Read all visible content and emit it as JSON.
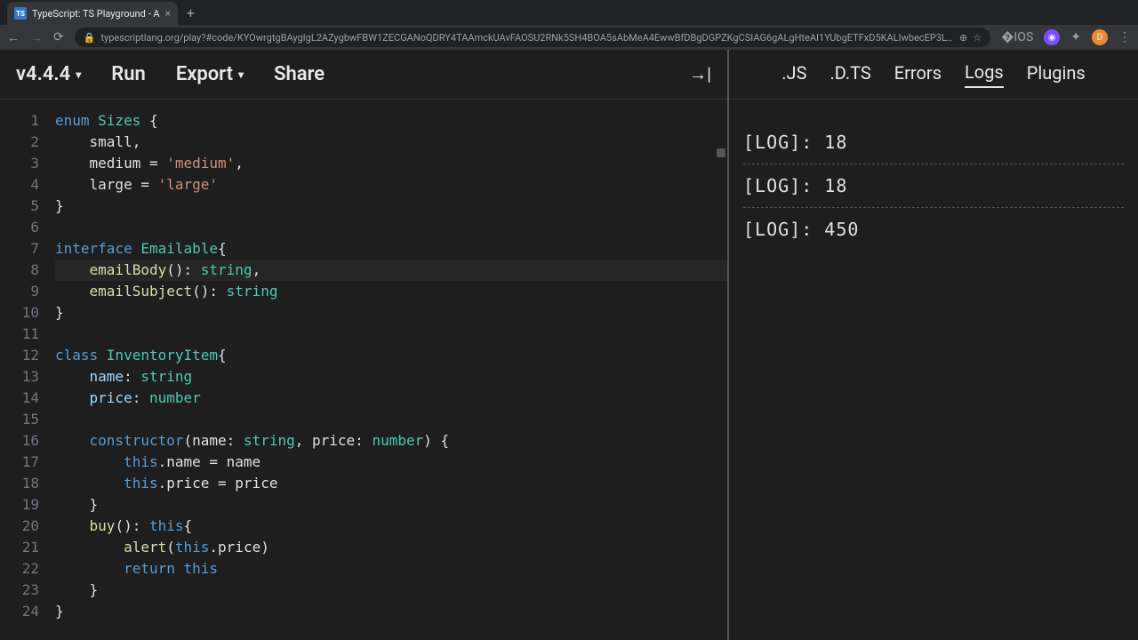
{
  "browser": {
    "tab_title": "TypeScript: TS Playground - A",
    "tab_favicon_text": "TS",
    "url": "typescriptlang.org/play?#code/KYOwrgtgBAygIgL2AZygbwFBW1ZECGANoQDRY4TAAmckUAvFAOSU2RNk5SH4BOA5sAbMeA4EwwBfDBgDGPZKgCSIAG6gALgHteAI1YUbgETFxD5KALIwbecEP3LYADrdnAr4CACNgvGV1ktEGQbMfItX..."
  },
  "toolbar": {
    "version": "v4.4.4",
    "run": "Run",
    "export": "Export",
    "share": "Share"
  },
  "code": {
    "lines": [
      {
        "n": 1,
        "tokens": [
          {
            "t": "enum ",
            "c": "kw"
          },
          {
            "t": "Sizes",
            "c": "type"
          },
          {
            "t": " {"
          }
        ]
      },
      {
        "n": 2,
        "tokens": [
          {
            "t": "    small,"
          }
        ]
      },
      {
        "n": 3,
        "tokens": [
          {
            "t": "    medium = "
          },
          {
            "t": "'medium'",
            "c": "str"
          },
          {
            "t": ","
          }
        ]
      },
      {
        "n": 4,
        "tokens": [
          {
            "t": "    large = "
          },
          {
            "t": "'large'",
            "c": "str"
          }
        ]
      },
      {
        "n": 5,
        "tokens": [
          {
            "t": "}"
          }
        ]
      },
      {
        "n": 6,
        "tokens": [
          {
            "t": ""
          }
        ]
      },
      {
        "n": 7,
        "tokens": [
          {
            "t": "interface ",
            "c": "kw"
          },
          {
            "t": "Emailable",
            "c": "type"
          },
          {
            "t": "{"
          }
        ]
      },
      {
        "n": 8,
        "active": true,
        "tokens": [
          {
            "t": "    "
          },
          {
            "t": "emailBody",
            "c": "fn"
          },
          {
            "t": "(): "
          },
          {
            "t": "string",
            "c": "type"
          },
          {
            "t": ","
          }
        ]
      },
      {
        "n": 9,
        "tokens": [
          {
            "t": "    "
          },
          {
            "t": "emailSubject",
            "c": "fn"
          },
          {
            "t": "(): "
          },
          {
            "t": "string",
            "c": "type"
          }
        ]
      },
      {
        "n": 10,
        "tokens": [
          {
            "t": "}"
          }
        ]
      },
      {
        "n": 11,
        "tokens": [
          {
            "t": ""
          }
        ]
      },
      {
        "n": 12,
        "tokens": [
          {
            "t": "class ",
            "c": "kw"
          },
          {
            "t": "InventoryItem",
            "c": "type"
          },
          {
            "t": "{"
          }
        ]
      },
      {
        "n": 13,
        "tokens": [
          {
            "t": "    "
          },
          {
            "t": "name",
            "c": "prop"
          },
          {
            "t": ": "
          },
          {
            "t": "string",
            "c": "type"
          }
        ]
      },
      {
        "n": 14,
        "tokens": [
          {
            "t": "    "
          },
          {
            "t": "price",
            "c": "prop"
          },
          {
            "t": ": "
          },
          {
            "t": "number",
            "c": "type"
          }
        ]
      },
      {
        "n": 15,
        "tokens": [
          {
            "t": ""
          }
        ]
      },
      {
        "n": 16,
        "tokens": [
          {
            "t": "    "
          },
          {
            "t": "constructor",
            "c": "kw"
          },
          {
            "t": "(name: "
          },
          {
            "t": "string",
            "c": "type"
          },
          {
            "t": ", price: "
          },
          {
            "t": "number",
            "c": "type"
          },
          {
            "t": ") {"
          }
        ]
      },
      {
        "n": 17,
        "tokens": [
          {
            "t": "        "
          },
          {
            "t": "this",
            "c": "this"
          },
          {
            "t": ".name = name"
          }
        ]
      },
      {
        "n": 18,
        "tokens": [
          {
            "t": "        "
          },
          {
            "t": "this",
            "c": "this"
          },
          {
            "t": ".price = price"
          }
        ]
      },
      {
        "n": 19,
        "tokens": [
          {
            "t": "    }"
          }
        ]
      },
      {
        "n": 20,
        "tokens": [
          {
            "t": "    "
          },
          {
            "t": "buy",
            "c": "fn"
          },
          {
            "t": "(): "
          },
          {
            "t": "this",
            "c": "this"
          },
          {
            "t": "{"
          }
        ]
      },
      {
        "n": 21,
        "tokens": [
          {
            "t": "        "
          },
          {
            "t": "alert",
            "c": "fn"
          },
          {
            "t": "("
          },
          {
            "t": "this",
            "c": "this"
          },
          {
            "t": ".price)"
          }
        ]
      },
      {
        "n": 22,
        "tokens": [
          {
            "t": "        "
          },
          {
            "t": "return ",
            "c": "kw"
          },
          {
            "t": "this",
            "c": "this"
          }
        ]
      },
      {
        "n": 23,
        "tokens": [
          {
            "t": "    }"
          }
        ]
      },
      {
        "n": 24,
        "tokens": [
          {
            "t": "}"
          }
        ]
      }
    ]
  },
  "output": {
    "tabs": [
      {
        "label": ".JS",
        "active": false
      },
      {
        "label": ".D.TS",
        "active": false
      },
      {
        "label": "Errors",
        "active": false
      },
      {
        "label": "Logs",
        "active": true
      },
      {
        "label": "Plugins",
        "active": false
      }
    ],
    "logs": [
      "[LOG]: 18",
      "[LOG]: 18",
      "[LOG]: 450"
    ]
  }
}
